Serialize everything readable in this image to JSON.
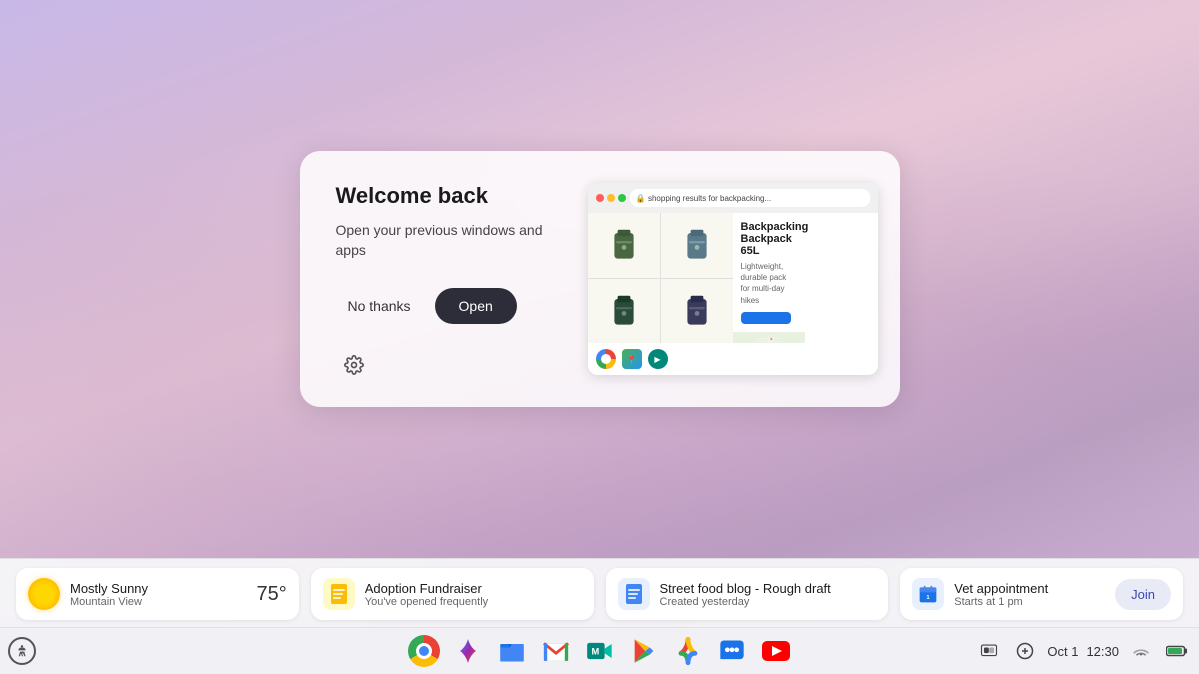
{
  "wallpaper": {
    "description": "Misty purple-pink gradient landscape"
  },
  "welcome_dialog": {
    "title": "Welcome back",
    "subtitle": "Open your previous windows and apps",
    "btn_no_thanks": "No thanks",
    "btn_open": "Open",
    "preview": {
      "product_title": "Backpacking Backpack 65L",
      "product_desc": "Lightweight, durable pack for multi-day hikes"
    }
  },
  "suggestions": [
    {
      "id": "weather",
      "title": "Mostly Sunny",
      "subtitle": "Mountain View",
      "right": "75°",
      "icon_type": "weather"
    },
    {
      "id": "fundraiser",
      "title": "Adoption Fundraiser",
      "subtitle": "You've opened frequently",
      "icon_type": "docs-yellow"
    },
    {
      "id": "blog",
      "title": "Street food blog - Rough draft",
      "subtitle": "Created yesterday",
      "icon_type": "docs-blue"
    },
    {
      "id": "vet",
      "title": "Vet appointment",
      "subtitle": "Starts at 1 pm",
      "icon_type": "calendar",
      "action": "Join"
    }
  ],
  "taskbar": {
    "apps": [
      {
        "id": "chrome",
        "label": "Google Chrome",
        "type": "chrome"
      },
      {
        "id": "gemini",
        "label": "Gemini",
        "type": "gemini"
      },
      {
        "id": "files",
        "label": "Files",
        "type": "files"
      },
      {
        "id": "gmail",
        "label": "Gmail",
        "type": "gmail"
      },
      {
        "id": "meet",
        "label": "Google Meet",
        "type": "meet"
      },
      {
        "id": "play",
        "label": "Google Play",
        "type": "play"
      },
      {
        "id": "photos",
        "label": "Google Photos",
        "type": "photos"
      },
      {
        "id": "chat",
        "label": "Google Chat",
        "type": "chat"
      },
      {
        "id": "youtube",
        "label": "YouTube",
        "type": "youtube"
      }
    ],
    "status": {
      "date": "Oct 1",
      "time": "12:30"
    }
  }
}
